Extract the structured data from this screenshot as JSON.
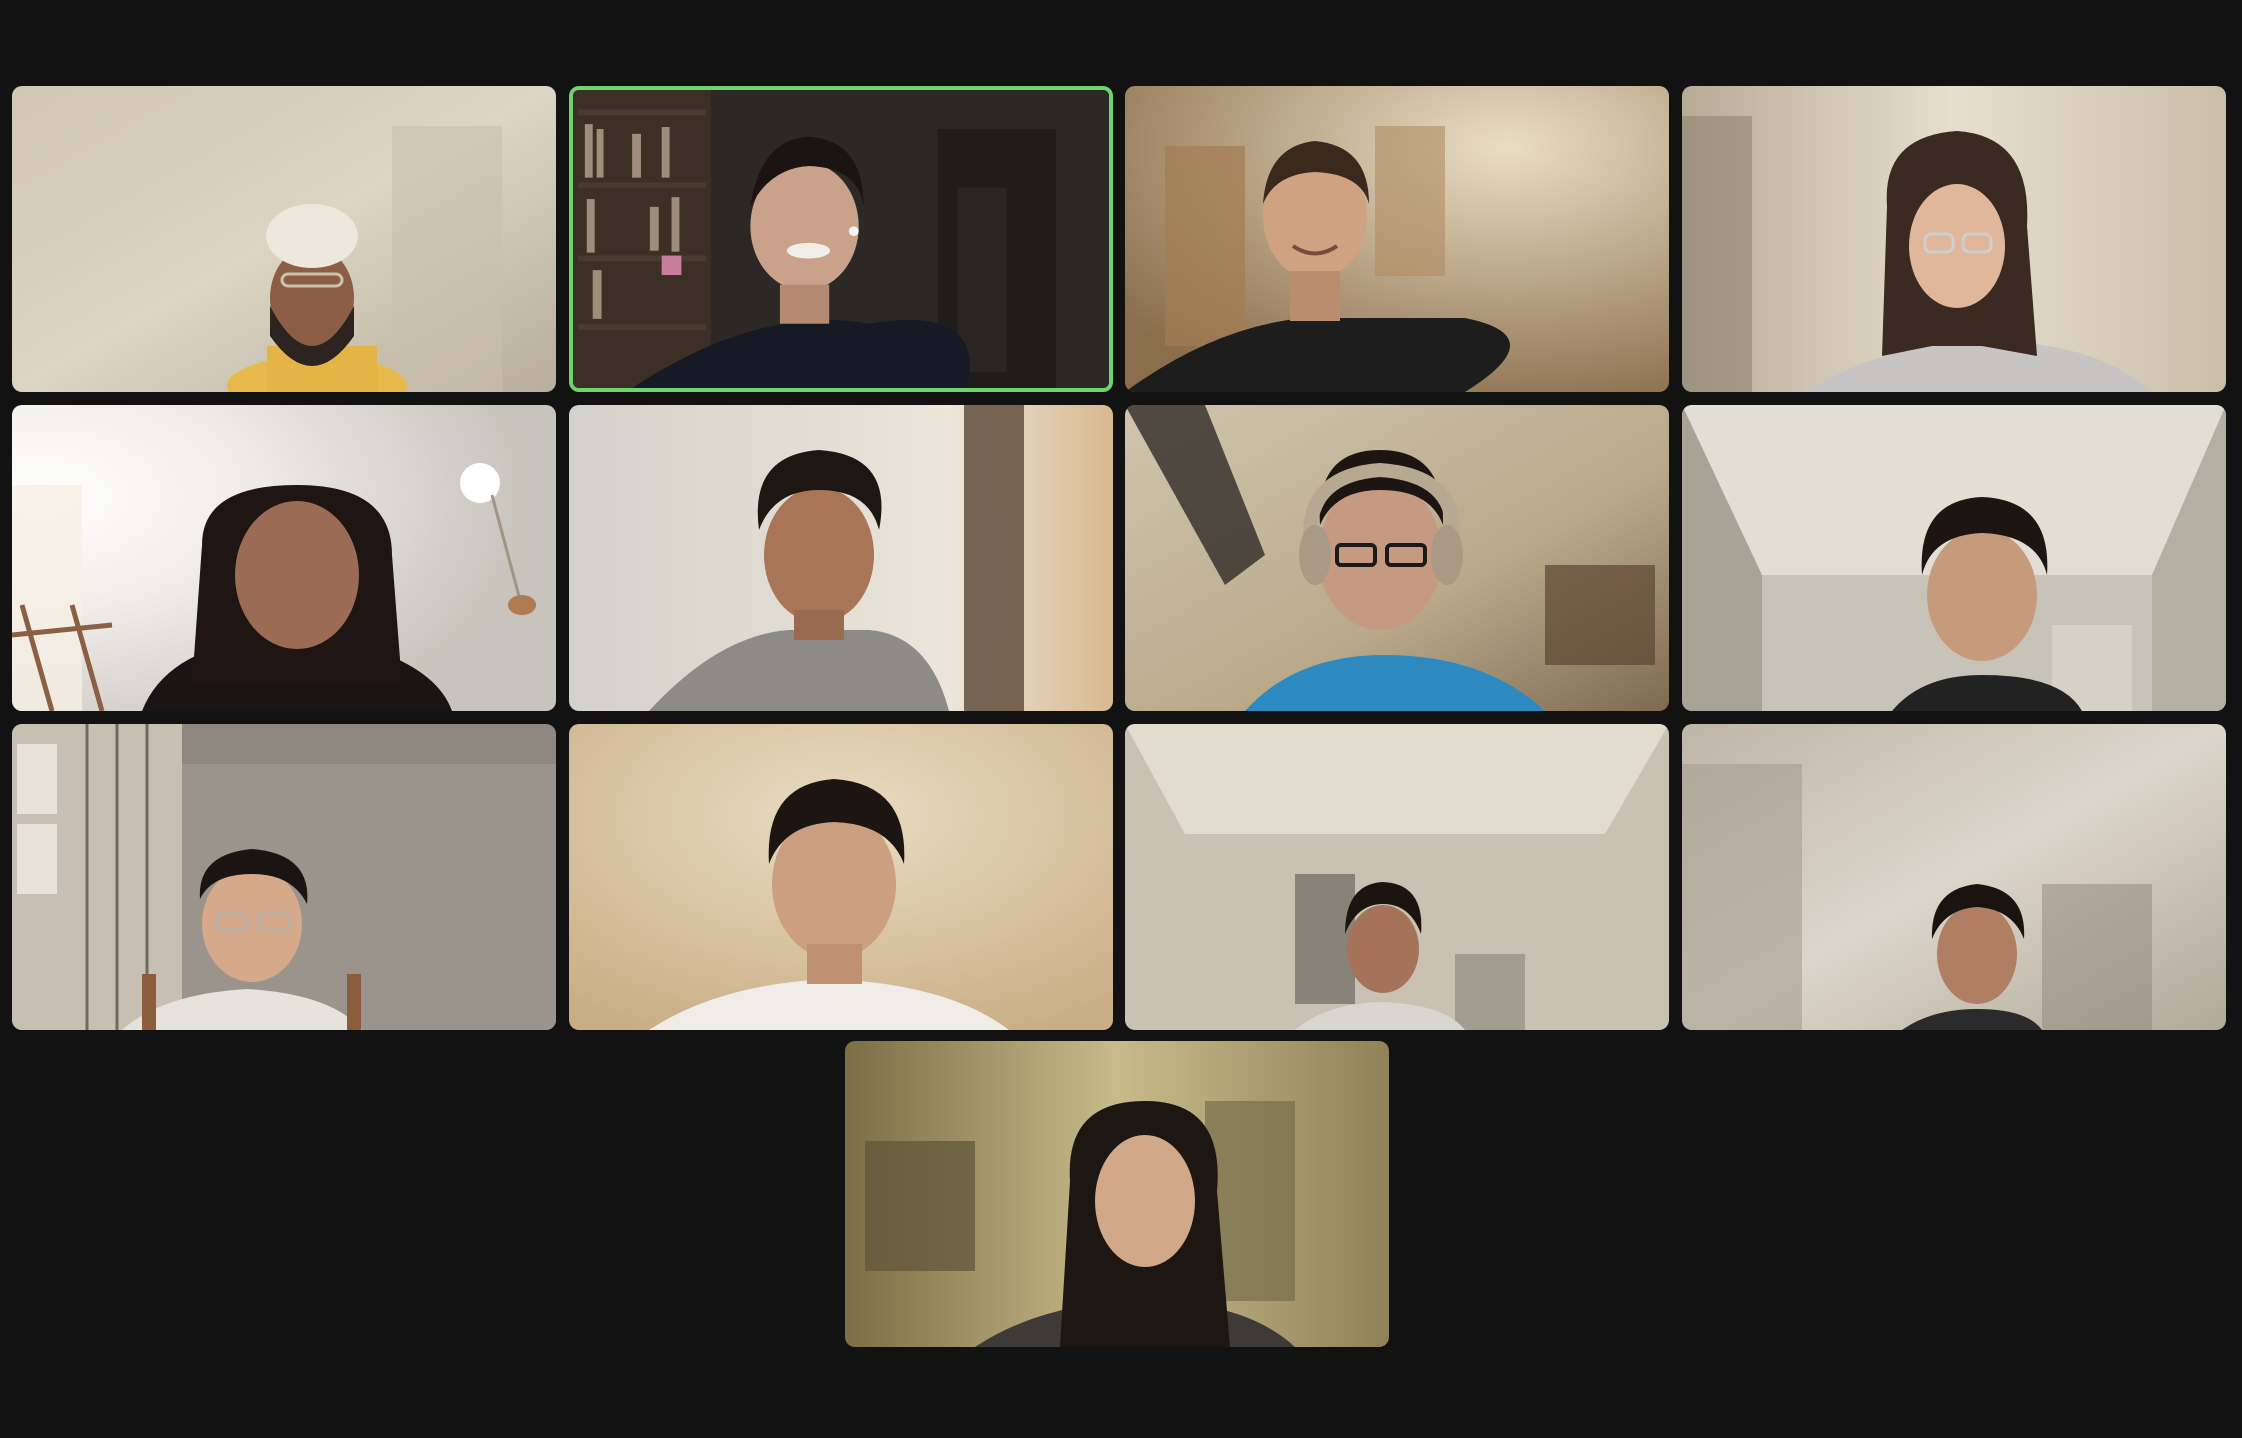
{
  "meeting": {
    "view": "gallery",
    "participant_count": 13,
    "active_speaker_index": 1,
    "accent_color": "#6fd46f",
    "background_color": "#121212"
  },
  "participants": [
    {
      "id": 1,
      "video": "on",
      "icon": "person-video"
    },
    {
      "id": 2,
      "video": "on",
      "icon": "person-video",
      "speaking": true
    },
    {
      "id": 3,
      "video": "on",
      "icon": "person-video"
    },
    {
      "id": 4,
      "video": "on",
      "icon": "person-video"
    },
    {
      "id": 5,
      "video": "on",
      "icon": "person-video"
    },
    {
      "id": 6,
      "video": "on",
      "icon": "person-video"
    },
    {
      "id": 7,
      "video": "on",
      "icon": "person-video"
    },
    {
      "id": 8,
      "video": "on",
      "icon": "person-video"
    },
    {
      "id": 9,
      "video": "on",
      "icon": "person-video"
    },
    {
      "id": 10,
      "video": "on",
      "icon": "person-video"
    },
    {
      "id": 11,
      "video": "on",
      "icon": "person-video"
    },
    {
      "id": 12,
      "video": "on",
      "icon": "person-video"
    },
    {
      "id": 13,
      "video": "on",
      "icon": "person-video"
    }
  ]
}
